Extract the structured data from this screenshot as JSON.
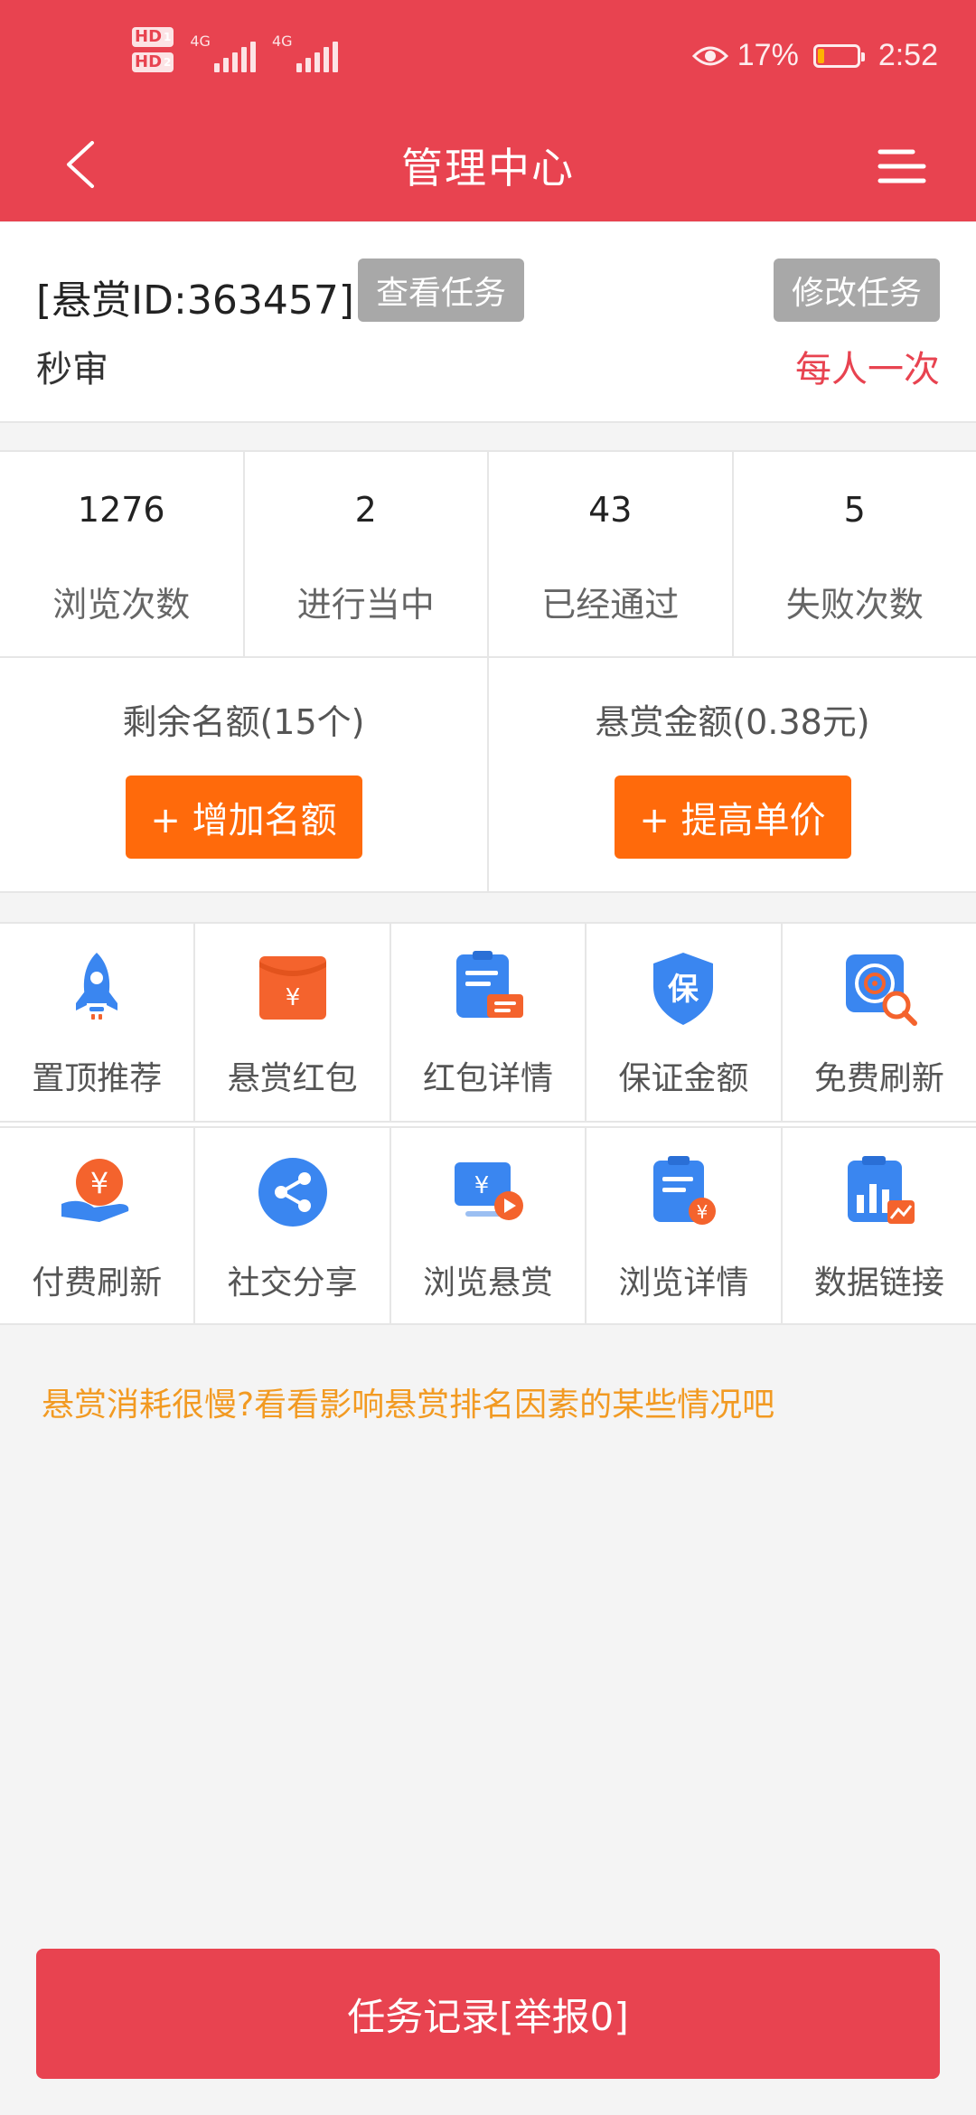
{
  "status_bar": {
    "hd1": "HD",
    "hd1_sub": "1",
    "hd2": "HD",
    "hd2_sub": "2",
    "net1": "4G",
    "net2": "4G",
    "battery_percent": "17%",
    "battery_level": 0.17,
    "time": "2:52",
    "battery_color": "#ffb200"
  },
  "nav": {
    "title": "管理中心",
    "back_icon": "chevron-left-icon",
    "menu_icon": "menu-icon"
  },
  "task": {
    "id_label": "[悬赏ID:363457]",
    "view_button": "查看任务",
    "edit_button": "修改任务",
    "subtitle": "秒审",
    "limit": "每人一次"
  },
  "stats": [
    {
      "value": "1276",
      "label": "浏览次数"
    },
    {
      "value": "2",
      "label": "进行当中"
    },
    {
      "value": "43",
      "label": "已经通过"
    },
    {
      "value": "5",
      "label": "失败次数"
    }
  ],
  "quota": {
    "remaining_label": "剩余名额(15个)",
    "add_button": "+ 增加名额",
    "amount_label": "悬赏金额(0.38元)",
    "raise_button": "+ 提高单价"
  },
  "grid": [
    [
      {
        "label": "置顶推荐",
        "icon": "rocket-icon"
      },
      {
        "label": "悬赏红包",
        "icon": "red-envelope-icon"
      },
      {
        "label": "红包详情",
        "icon": "clipboard-detail-icon"
      },
      {
        "label": "保证金额",
        "icon": "shield-deposit-icon"
      },
      {
        "label": "免费刷新",
        "icon": "target-search-icon"
      }
    ],
    [
      {
        "label": "付费刷新",
        "icon": "yuan-hand-icon"
      },
      {
        "label": "社交分享",
        "icon": "share-icon"
      },
      {
        "label": "浏览悬赏",
        "icon": "video-reward-icon"
      },
      {
        "label": "浏览详情",
        "icon": "clipboard-yuan-icon"
      },
      {
        "label": "数据链接",
        "icon": "chart-link-icon"
      }
    ]
  ],
  "icon_glyphs": {
    "yuan": "¥",
    "bao": "保"
  },
  "tip": "悬赏消耗很慢?看看影响悬赏排名因素的某些情况吧",
  "bottom_button": "任务记录[举报0]",
  "colors": {
    "primary": "#e84350",
    "orange": "#ff6a0b",
    "icon_blue": "#3a86f0",
    "icon_orange": "#f4632d",
    "tip": "#f29a22",
    "gray_button": "#a8a8a8"
  }
}
